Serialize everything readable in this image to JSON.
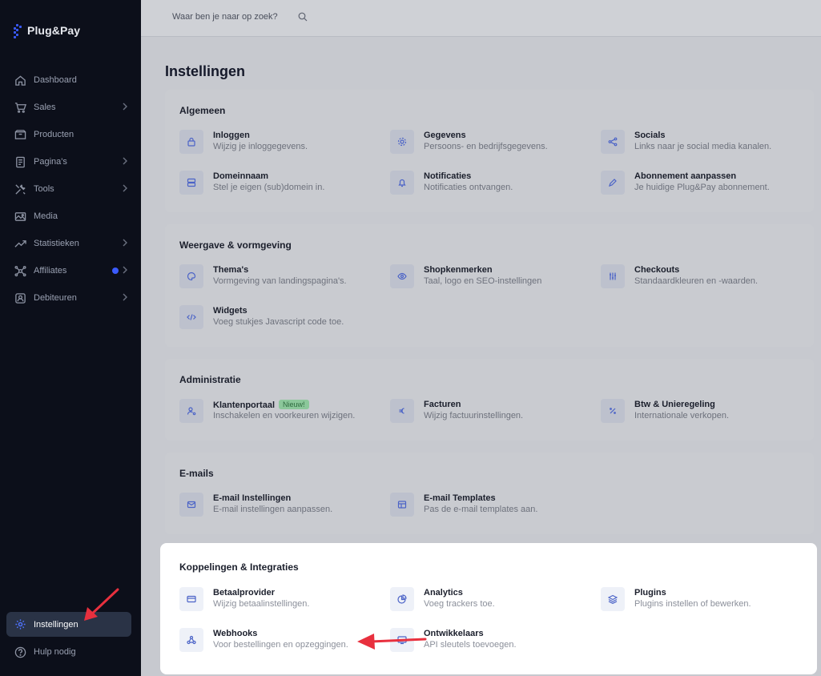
{
  "brand": {
    "name": "Plug&Pay"
  },
  "search": {
    "placeholder": "Waar ben je naar op zoek?"
  },
  "sidebar": {
    "items": [
      {
        "label": "Dashboard",
        "icon": "home-icon",
        "chevron": false
      },
      {
        "label": "Sales",
        "icon": "cart-icon",
        "chevron": true
      },
      {
        "label": "Producten",
        "icon": "box-icon",
        "chevron": false
      },
      {
        "label": "Pagina's",
        "icon": "page-icon",
        "chevron": true
      },
      {
        "label": "Tools",
        "icon": "tools-icon",
        "chevron": true
      },
      {
        "label": "Media",
        "icon": "media-icon",
        "chevron": false
      },
      {
        "label": "Statistieken",
        "icon": "trend-icon",
        "chevron": true
      },
      {
        "label": "Affiliates",
        "icon": "network-icon",
        "chevron": true
      },
      {
        "label": "Debiteuren",
        "icon": "debtor-icon",
        "chevron": true
      }
    ],
    "bottom": [
      {
        "label": "Instellingen",
        "icon": "gear-icon",
        "active": true
      },
      {
        "label": "Hulp nodig",
        "icon": "help-icon",
        "active": false
      }
    ]
  },
  "page": {
    "title": "Instellingen"
  },
  "sections": [
    {
      "title": "Algemeen",
      "items": [
        {
          "title": "Inloggen",
          "desc": "Wijzig je inloggegevens.",
          "icon": "lock-icon"
        },
        {
          "title": "Gegevens",
          "desc": "Persoons- en bedrijfsgegevens.",
          "icon": "settings-icon"
        },
        {
          "title": "Socials",
          "desc": "Links naar je social media kanalen.",
          "icon": "share-icon"
        },
        {
          "title": "Domeinnaam",
          "desc": "Stel je eigen (sub)domein in.",
          "icon": "server-icon"
        },
        {
          "title": "Notificaties",
          "desc": "Notificaties ontvangen.",
          "icon": "bell-icon"
        },
        {
          "title": "Abonnement aanpassen",
          "desc": "Je huidige Plug&Pay abonnement.",
          "icon": "pencil-icon"
        }
      ]
    },
    {
      "title": "Weergave & vormgeving",
      "items": [
        {
          "title": "Thema's",
          "desc": "Vormgeving van landingspagina's.",
          "icon": "palette-icon"
        },
        {
          "title": "Shopkenmerken",
          "desc": "Taal, logo en SEO-instellingen",
          "icon": "eye-icon"
        },
        {
          "title": "Checkouts",
          "desc": "Standaardkleuren en -waarden.",
          "icon": "sliders-icon"
        },
        {
          "title": "Widgets",
          "desc": "Voeg stukjes Javascript code toe.",
          "icon": "code-icon"
        }
      ]
    },
    {
      "title": "Administratie",
      "items": [
        {
          "title": "Klantenportaal",
          "desc": "Inschakelen en voorkeuren wijzigen.",
          "icon": "user-gear-icon",
          "badge": "Nieuw!"
        },
        {
          "title": "Facturen",
          "desc": "Wijzig factuurinstellingen.",
          "icon": "euro-icon"
        },
        {
          "title": "Btw & Unieregeling",
          "desc": "Internationale verkopen.",
          "icon": "percent-icon"
        }
      ]
    },
    {
      "title": "E-mails",
      "items": [
        {
          "title": "E-mail Instellingen",
          "desc": "E-mail instellingen aanpassen.",
          "icon": "mail-icon"
        },
        {
          "title": "E-mail Templates",
          "desc": "Pas de e-mail templates aan.",
          "icon": "template-icon"
        }
      ]
    },
    {
      "title": "Koppelingen & Integraties",
      "items": [
        {
          "title": "Betaalprovider",
          "desc": "Wijzig betaalinstellingen.",
          "icon": "card-icon"
        },
        {
          "title": "Analytics",
          "desc": "Voeg trackers toe.",
          "icon": "pie-icon"
        },
        {
          "title": "Plugins",
          "desc": "Plugins instellen of bewerken.",
          "icon": "layers-icon"
        },
        {
          "title": "Webhooks",
          "desc": "Voor bestellingen en opzeggingen.",
          "icon": "webhook-icon"
        },
        {
          "title": "Ontwikkelaars",
          "desc": "API sleutels toevoegen.",
          "icon": "monitor-icon"
        }
      ]
    }
  ],
  "colors": {
    "accent": "#3b5bfd",
    "annotation": "#e8303e",
    "sidebar": "#0c0f1a"
  }
}
